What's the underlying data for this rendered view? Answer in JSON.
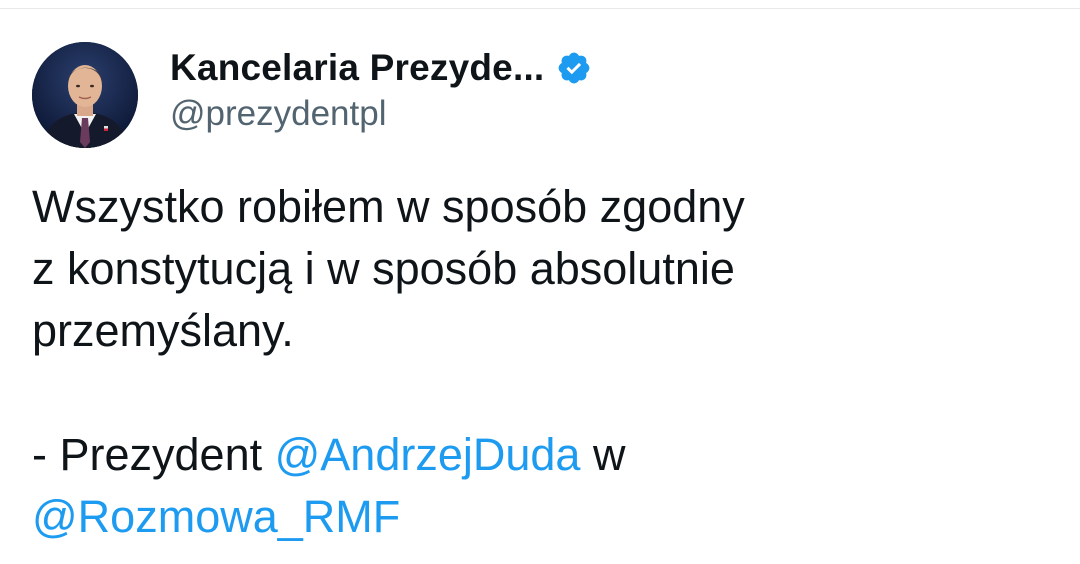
{
  "tweet": {
    "author": {
      "display_name": "Kancelaria Prezyde...",
      "handle": "@prezydentpl",
      "verified_icon": "verified-badge-icon",
      "avatar": "profile-photo"
    },
    "body": {
      "line1": "Wszystko robiłem w sposób zgodny",
      "line2": "z konstytucją i w sposób absolutnie",
      "line3": "przemyślany.",
      "line4_prefix": "- Prezydent ",
      "line4_mention": "@AndrzejDuda",
      "line4_suffix": " w",
      "line5_mention": "@Rozmowa_RMF"
    }
  },
  "colors": {
    "text": "#0f1419",
    "secondary": "#536471",
    "accent": "#1d9bf0",
    "divider": "#e7e9ea"
  }
}
